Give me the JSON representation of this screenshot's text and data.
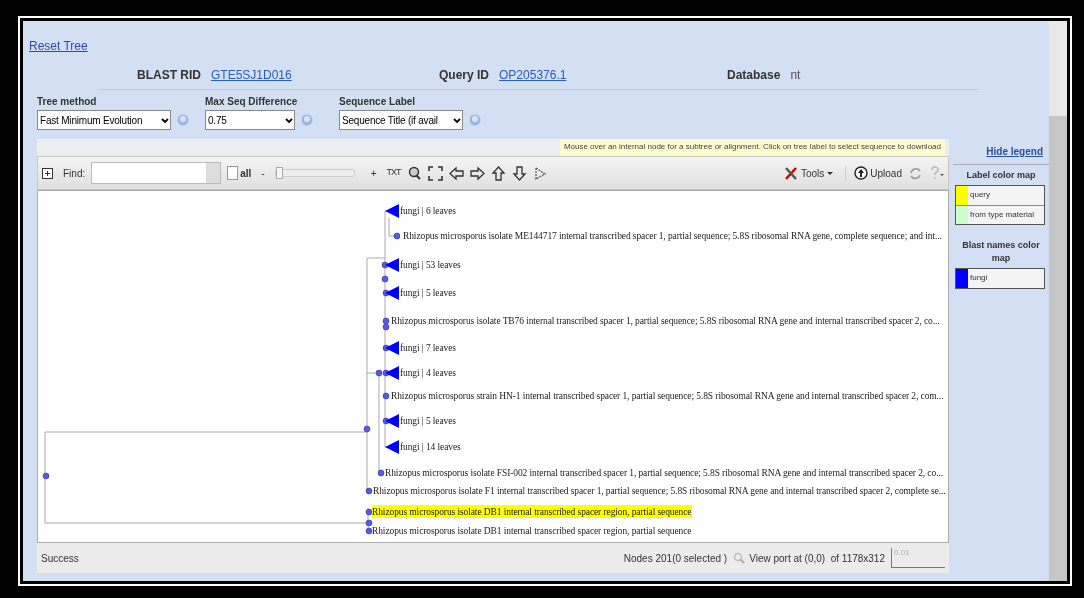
{
  "header": {
    "reset_link": "Reset Tree",
    "fields": [
      {
        "label": "BLAST RID",
        "value": "GTE5SJ1D016",
        "link": true
      },
      {
        "label": "Query ID",
        "value": "OP205376.1",
        "link": true
      },
      {
        "label": "Database",
        "value": "nt",
        "link": false
      }
    ]
  },
  "options": [
    {
      "label": "Tree method",
      "value": "Fast Minimum Evolution"
    },
    {
      "label": "Max Seq Difference",
      "value": "0.75"
    },
    {
      "label": "Sequence Label",
      "value": "Sequence Title (if avail"
    }
  ],
  "hint": "Mouse over an internal node for a subtree or alignment. Click on tree label to select sequence to download",
  "hide_legend": "Hide legend",
  "toolbar": {
    "find_label": "Find:",
    "all_checkbox": {
      "label": "all",
      "checked": false
    },
    "zoom_out": "-",
    "zoom_in": "+",
    "zoom": {
      "level": 0
    },
    "txt": "TXT",
    "tools": "Tools",
    "upload": "Upload"
  },
  "tree": {
    "leaves": [
      {
        "kind": "group",
        "label": "fungi | 6 leaves",
        "query": false
      },
      {
        "kind": "sequence",
        "label": "Rhizopus microsporus isolate ME144717 internal transcribed spacer 1, partial sequence; 5.8S ribosomal RNA gene, complete sequence; and int...",
        "query": false
      },
      {
        "kind": "group",
        "label": "fungi | 53 leaves",
        "query": false
      },
      {
        "kind": "group",
        "label": "fungi | 5 leaves",
        "query": false
      },
      {
        "kind": "sequence",
        "label": "Rhizopus microsporus isolate TB76 internal transcribed spacer 1, partial sequence; 5.8S ribosomal RNA gene and internal transcribed spacer 2, co...",
        "query": false
      },
      {
        "kind": "group",
        "label": "fungi | 7 leaves",
        "query": false
      },
      {
        "kind": "group",
        "label": "fungi | 4 leaves",
        "query": false
      },
      {
        "kind": "sequence",
        "label": "Rhizopus microsporus strain HN-1 internal transcribed spacer 1, partial sequence; 5.8S ribosomal RNA gene and internal transcribed spacer 2, com...",
        "query": false
      },
      {
        "kind": "group",
        "label": "fungi | 5 leaves",
        "query": false
      },
      {
        "kind": "group",
        "label": "fungi | 14 leaves",
        "query": false
      },
      {
        "kind": "sequence",
        "label": "Rhizopus microsporus isolate FSI-002 internal transcribed spacer 1, partial sequence; 5.8S ribosomal RNA gene and internal transcribed spacer 2, co...",
        "query": false
      },
      {
        "kind": "sequence",
        "label": "Rhizopus microsporus isolate F1 internal transcribed spacer 1, partial sequence; 5.8S ribosomal RNA gene and internal transcribed spacer 2, complete se...",
        "query": false
      },
      {
        "kind": "sequence",
        "label": "Rhizopus microsporus isolate DB1 internal transcribed spacer region, partial sequence",
        "query": true
      },
      {
        "kind": "sequence",
        "label": "Rhizopus microsporus isolate DB1 internal transcribed spacer region, partial sequence",
        "query": false
      }
    ]
  },
  "status_bar": {
    "message": "Success",
    "nodes": "Nodes 201(0 selected )",
    "viewport": "View port at (0,0)  of 1178x312",
    "scale": "0.01"
  },
  "legend": {
    "label_color_map": {
      "title": "Label color map",
      "items": [
        {
          "label": "query",
          "color": "#ffff00"
        },
        {
          "label": "from type material",
          "color": "#ccffcc"
        }
      ]
    },
    "blast_names_color_map": {
      "title": "Blast names color map",
      "items": [
        {
          "label": "fungi",
          "color": "#0000ff"
        }
      ]
    }
  }
}
